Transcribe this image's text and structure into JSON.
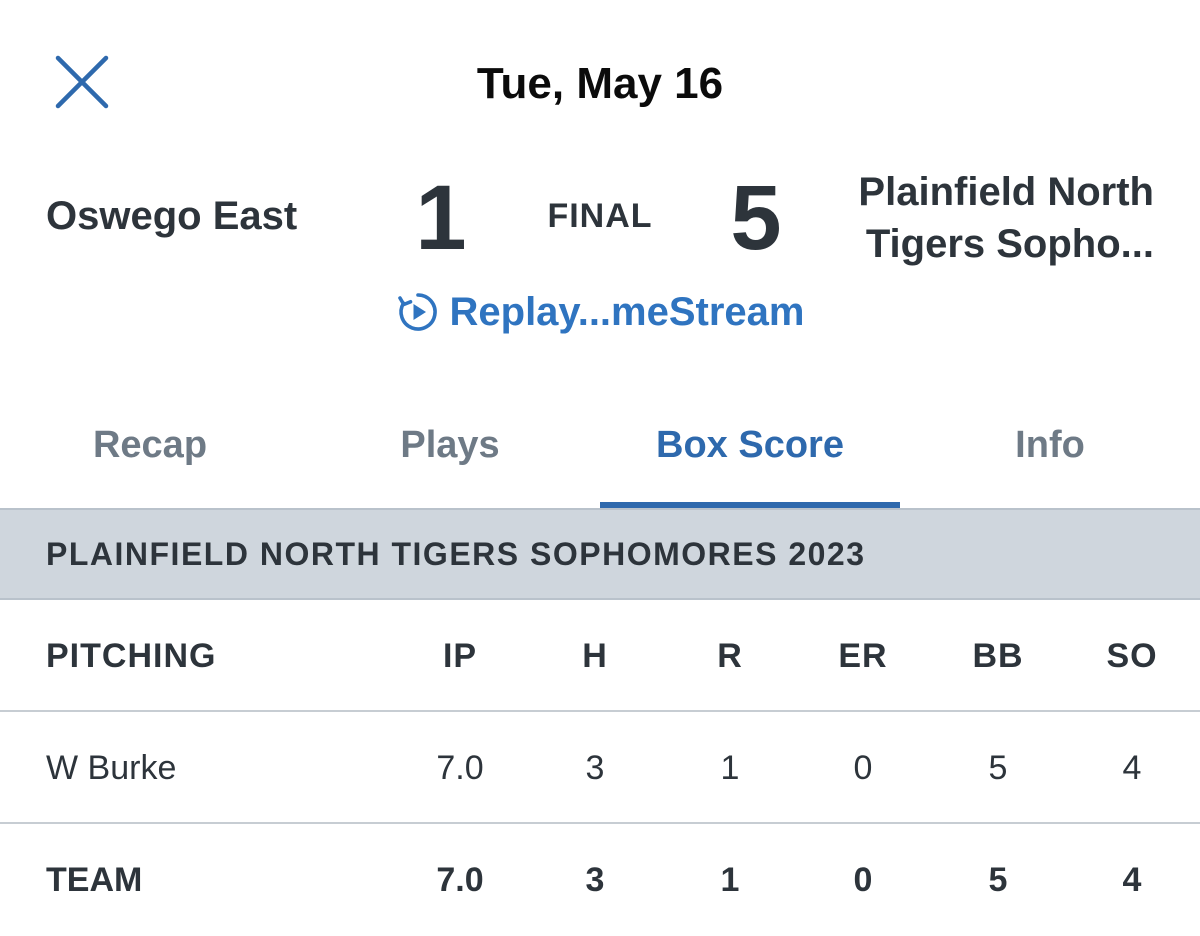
{
  "header": {
    "date": "Tue, May 16",
    "close_icon": "close-icon"
  },
  "game": {
    "away_team": "Oswego East",
    "away_score": "1",
    "status": "FINAL",
    "home_score": "5",
    "home_team_line1": "Plainfield North",
    "home_team_line2": "Tigers Sopho..."
  },
  "replay": {
    "icon": "replay-icon",
    "label": "Replay...meStream"
  },
  "tabs": [
    {
      "label": "Recap",
      "active": false
    },
    {
      "label": "Plays",
      "active": false
    },
    {
      "label": "Box Score",
      "active": true
    },
    {
      "label": "Info",
      "active": false
    }
  ],
  "box_score": {
    "team_title": "PLAINFIELD NORTH TIGERS SOPHOMORES 2023",
    "pitching": {
      "columns": [
        "PITCHING",
        "IP",
        "H",
        "R",
        "ER",
        "BB",
        "SO"
      ],
      "rows": [
        {
          "name": "W Burke",
          "ip": "7.0",
          "h": "3",
          "r": "1",
          "er": "0",
          "bb": "5",
          "so": "4"
        }
      ],
      "total": {
        "name": "TEAM",
        "ip": "7.0",
        "h": "3",
        "r": "1",
        "er": "0",
        "bb": "5",
        "so": "4"
      }
    }
  },
  "colors": {
    "accent": "#2e69ad",
    "link": "#2f74c0",
    "banner": "#cfd6dd",
    "text": "#2d343b",
    "inactive_tab": "#6e7a86"
  }
}
